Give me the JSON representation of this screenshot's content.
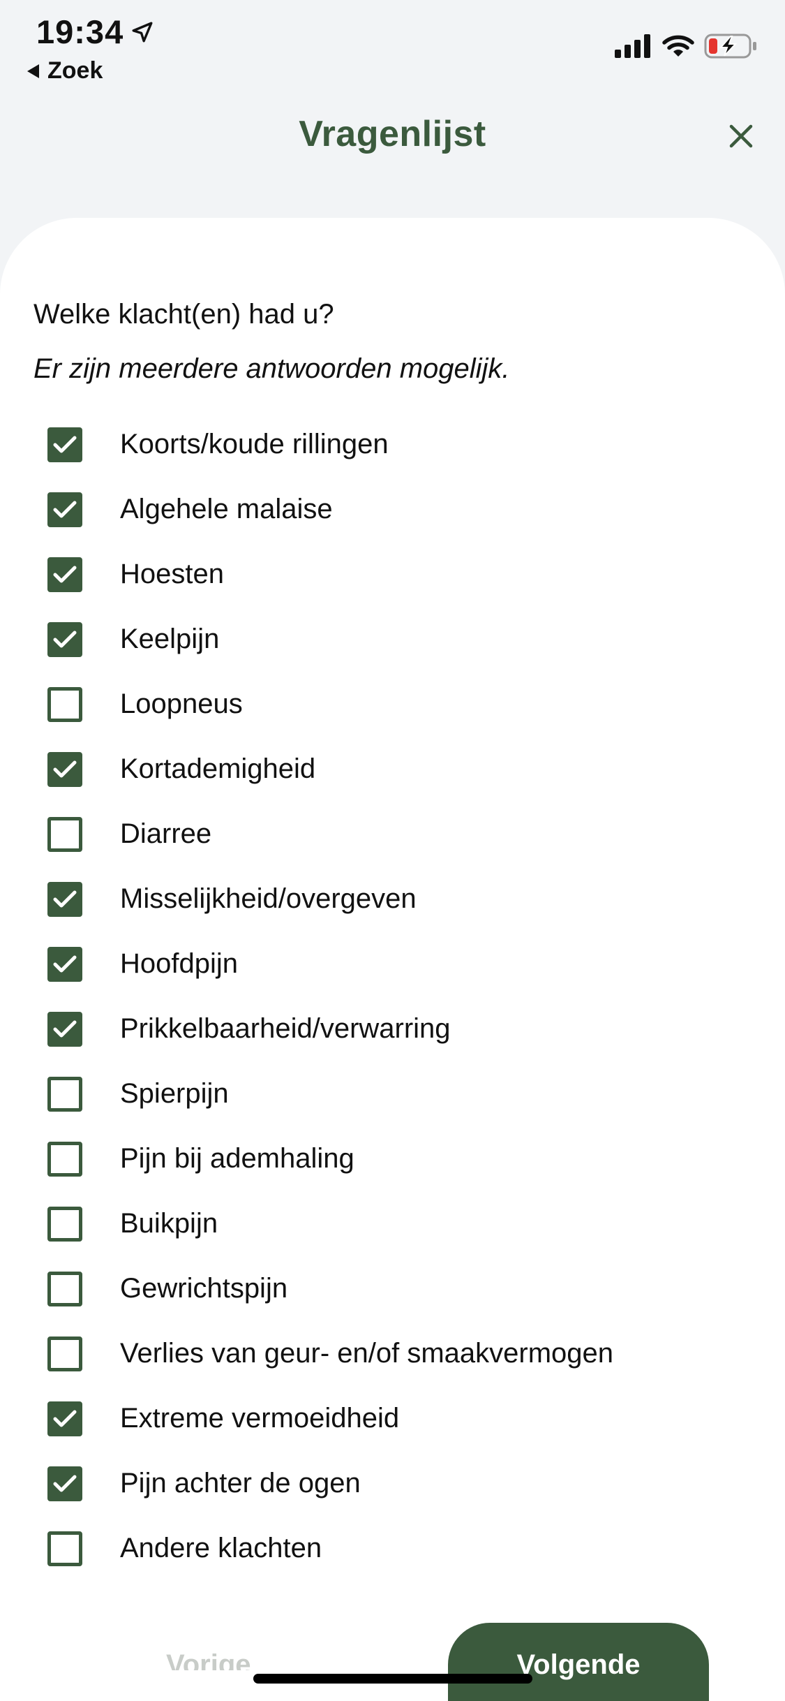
{
  "status_bar": {
    "time": "19:34",
    "back_label": "Zoek"
  },
  "header": {
    "title": "Vragenlijst"
  },
  "question": {
    "text": "Welke klacht(en) had u?",
    "hint": "Er zijn meerdere antwoorden mogelijk."
  },
  "options": [
    {
      "label": "Koorts/koude rillingen",
      "checked": true
    },
    {
      "label": "Algehele malaise",
      "checked": true
    },
    {
      "label": "Hoesten",
      "checked": true
    },
    {
      "label": "Keelpijn",
      "checked": true
    },
    {
      "label": "Loopneus",
      "checked": false
    },
    {
      "label": "Kortademigheid",
      "checked": true
    },
    {
      "label": "Diarree",
      "checked": false
    },
    {
      "label": "Misselijkheid/overgeven",
      "checked": true
    },
    {
      "label": "Hoofdpijn",
      "checked": true
    },
    {
      "label": "Prikkelbaarheid/verwarring",
      "checked": true
    },
    {
      "label": "Spierpijn",
      "checked": false
    },
    {
      "label": "Pijn bij ademhaling",
      "checked": false
    },
    {
      "label": "Buikpijn",
      "checked": false
    },
    {
      "label": "Gewrichtspijn",
      "checked": false
    },
    {
      "label": "Verlies van geur- en/of smaakvermogen",
      "checked": false
    },
    {
      "label": "Extreme vermoeidheid",
      "checked": true
    },
    {
      "label": "Pijn achter de ogen",
      "checked": true
    },
    {
      "label": "Andere klachten",
      "checked": false
    }
  ],
  "footer": {
    "prev_label": "Vorige",
    "next_label": "Volgende"
  },
  "colors": {
    "accent": "#3b5a3d",
    "background": "#f2f4f6",
    "card": "#ffffff",
    "battery_low": "#e5352f"
  }
}
